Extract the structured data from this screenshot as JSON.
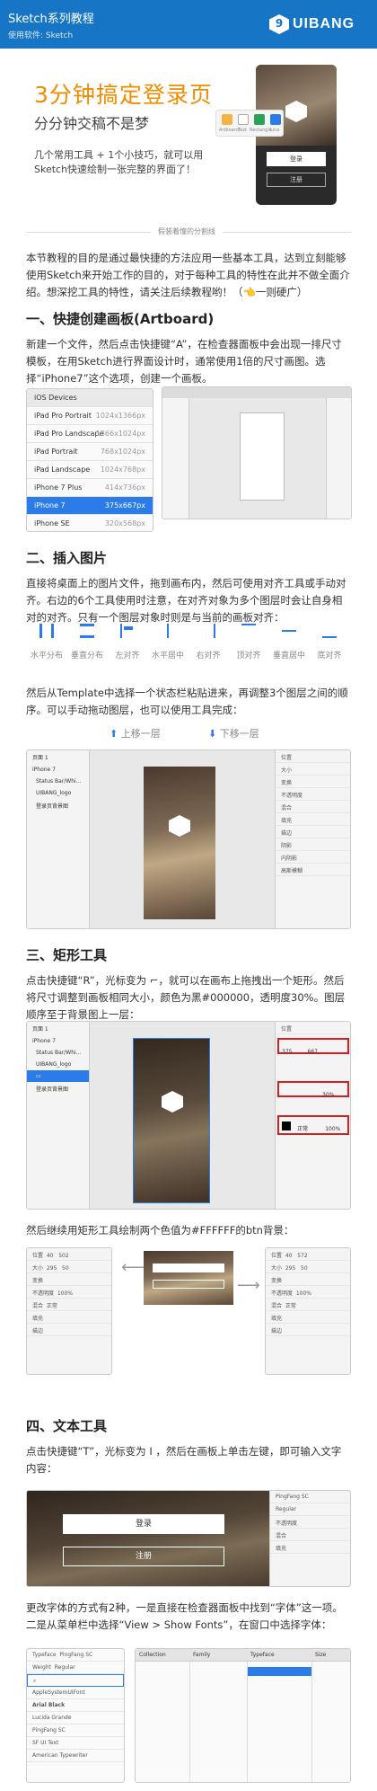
{
  "header": {
    "title": "Sketch系列教程",
    "subtitle": "使用软件: Sketch",
    "logo_mark": "9",
    "logo_text": "UIBANG"
  },
  "hero": {
    "title": "3分钟搞定登录页",
    "subtitle": "分分钟交稿不是梦",
    "desc": "几个常用工具 + 1个小技巧，就可以用Sketch快速绘制一张完整的界面了！",
    "phone_btn_login": "登录",
    "phone_btn_register": "注册",
    "toolbar_labels": [
      "Artboard",
      "Text",
      "Rectangle",
      "Line"
    ]
  },
  "divider_text": "假装着憧的分割线",
  "intro": "本节教程的目的是通过最快捷的方法应用一些基本工具，达到立刻能够使用Sketch来开始工作的目的，对于每种工具的特性在此并不做全面介绍。想深挖工具的特性，请关注后续教程哟！（👈一则硬广）",
  "s1": {
    "title": "一、快捷创建画板(Artboard)",
    "text": "新建一个文件，然后点击快捷键“A”，在检查器面板中会出现一排尺寸模板，在用Sketch进行界面设计时，通常使用1倍的尺寸画图。选择“iPhone7”这个选项，创建一个画板。",
    "devices_header": "iOS Devices",
    "devices": [
      {
        "name": "iPad Pro Portrait",
        "size": "1024x1366px"
      },
      {
        "name": "iPad Pro Landscape",
        "size": "1366x1024px"
      },
      {
        "name": "iPad Portrait",
        "size": "768x1024px"
      },
      {
        "name": "iPad Landscape",
        "size": "1024x768px"
      },
      {
        "name": "iPhone 7 Plus",
        "size": "414x736px"
      },
      {
        "name": "iPhone 7",
        "size": "375x667px"
      },
      {
        "name": "iPhone SE",
        "size": "320x568px"
      }
    ]
  },
  "s2": {
    "title": "二、插入图片",
    "text": "直接将桌面上的图片文件，拖到画布内，然后可使用对齐工具或手动对齐。右边的6个工具使用时注意，在对齐对象为多个图层时会让自身相对的对齐。只有一个图层对象时则是与当前的画板对齐：",
    "align_labels": [
      "水平分布",
      "垂直分布",
      "左对齐",
      "水平居中",
      "右对齐",
      "顶对齐",
      "垂直居中",
      "底对齐"
    ],
    "text2": "然后从Template中选择一个状态栏粘贴进来，再调整3个图层之间的顺序。可以手动拖动图层，也可以使用工具完成：",
    "up_label": "上移一层",
    "down_label": "下移一层",
    "layers": [
      "页面 1",
      "iPhone 7",
      "Status Bar/Whi...",
      "UIBANG_logo",
      "登录页背景图"
    ],
    "inspector": [
      "位置",
      "大小",
      "变换",
      "不透明度",
      "混合",
      "正常",
      "填充",
      "描边",
      "阴影",
      "内阴影",
      "高斯模糊"
    ]
  },
  "s3": {
    "title": "三、矩形工具",
    "text": "点击快捷键“R”，光标变为 ⌐，就可以在画布上拖拽出一个矩形。然后将尺寸调整到画板相同大小，颜色为黑#000000，透明度30%。图层顺序至于背景图上一层：",
    "size_w": "375",
    "size_h": "667",
    "opacity": "30%",
    "fill_blend": "正常",
    "fill_pct": "100%",
    "text2": "然后继续用矩形工具绘制两个色值为#FFFFFF的btn背景：",
    "left_panel": {
      "x": "40",
      "y": "502",
      "w": "295",
      "h": "50",
      "opacity": "100%"
    },
    "right_panel": {
      "x": "40",
      "y": "572",
      "w": "295",
      "h": "50",
      "opacity": "100%"
    }
  },
  "s4": {
    "title": "四、文本工具",
    "text": "点击快捷键“T”，光标变为 I ，然后在画板上单击左键，即可输入文字内容：",
    "btn_login": "登录",
    "btn_register": "注册",
    "font_name": "PingFang SC",
    "font_weight": "Regular",
    "text2": "更改字体的方式有2种，一是直接在检查器面板中找到“字体”这一项。二是从菜单栏中选择“View > Show Fonts”，在窗口中选择字体：",
    "font_list": [
      "AppleSystemUIFont",
      "Arial Black",
      "Lucida Grande",
      "PingFang SC",
      "SF UI Text",
      "American Typewriter"
    ],
    "typeface_label": "Typeface",
    "weight_label": "Weight",
    "collections_header": [
      "Collection",
      "Family",
      "Typeface",
      "Size"
    ]
  },
  "colors": {
    "brand": "#1675c4",
    "accent": "#f08c00",
    "select": "#2b7ce8",
    "highlight": "#d21f1f"
  }
}
